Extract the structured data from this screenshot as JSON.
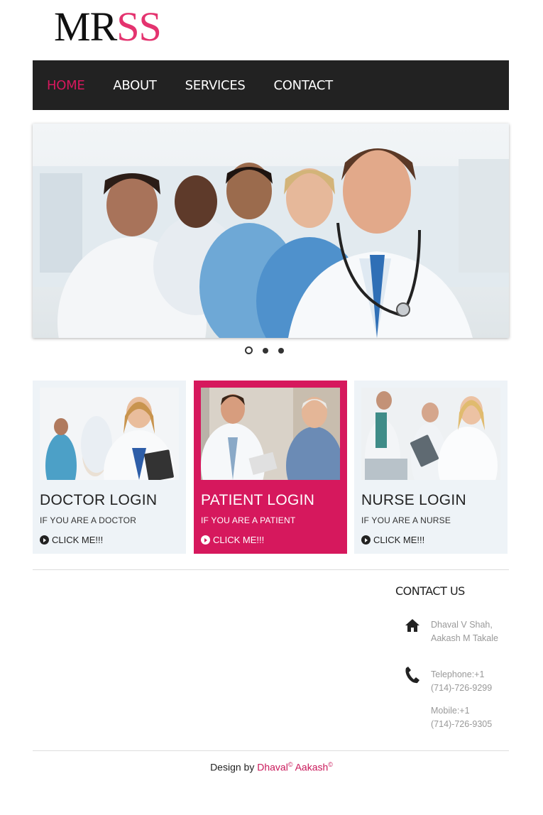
{
  "logo": {
    "part1": "MR",
    "part2": "SS"
  },
  "nav": {
    "items": [
      "HOME",
      "ABOUT",
      "SERVICES",
      "CONTACT"
    ],
    "active": "HOME"
  },
  "carousel": {
    "slides": 3,
    "active_slide": 1
  },
  "cards": [
    {
      "title": "DOCTOR LOGIN",
      "subtitle": "IF YOU ARE A DOCTOR",
      "cta": "CLICK ME!!!"
    },
    {
      "title": "PATIENT LOGIN",
      "subtitle": "IF YOU ARE A PATIENT",
      "cta": "CLICK ME!!!"
    },
    {
      "title": "NURSE LOGIN",
      "subtitle": "IF YOU ARE A NURSE",
      "cta": "CLICK ME!!!"
    }
  ],
  "contact": {
    "title": "CONTACT US",
    "name_line1": "Dhaval V Shah,",
    "name_line2": "Aakash M Takale",
    "tel_line1": "Telephone:+1",
    "tel_line2": "(714)-726-9299",
    "mob_line1": "Mobile:+1",
    "mob_line2": "(714)-726-9305",
    "icons": [
      "home-icon",
      "phone-icon"
    ]
  },
  "footer": {
    "prefix": "Design by ",
    "author1": "Dhaval",
    "author2": "Aakash",
    "copyright": "©"
  },
  "colors": {
    "accent": "#d6185d",
    "nav_bg": "#222222",
    "card_bg": "#eef3f7"
  }
}
